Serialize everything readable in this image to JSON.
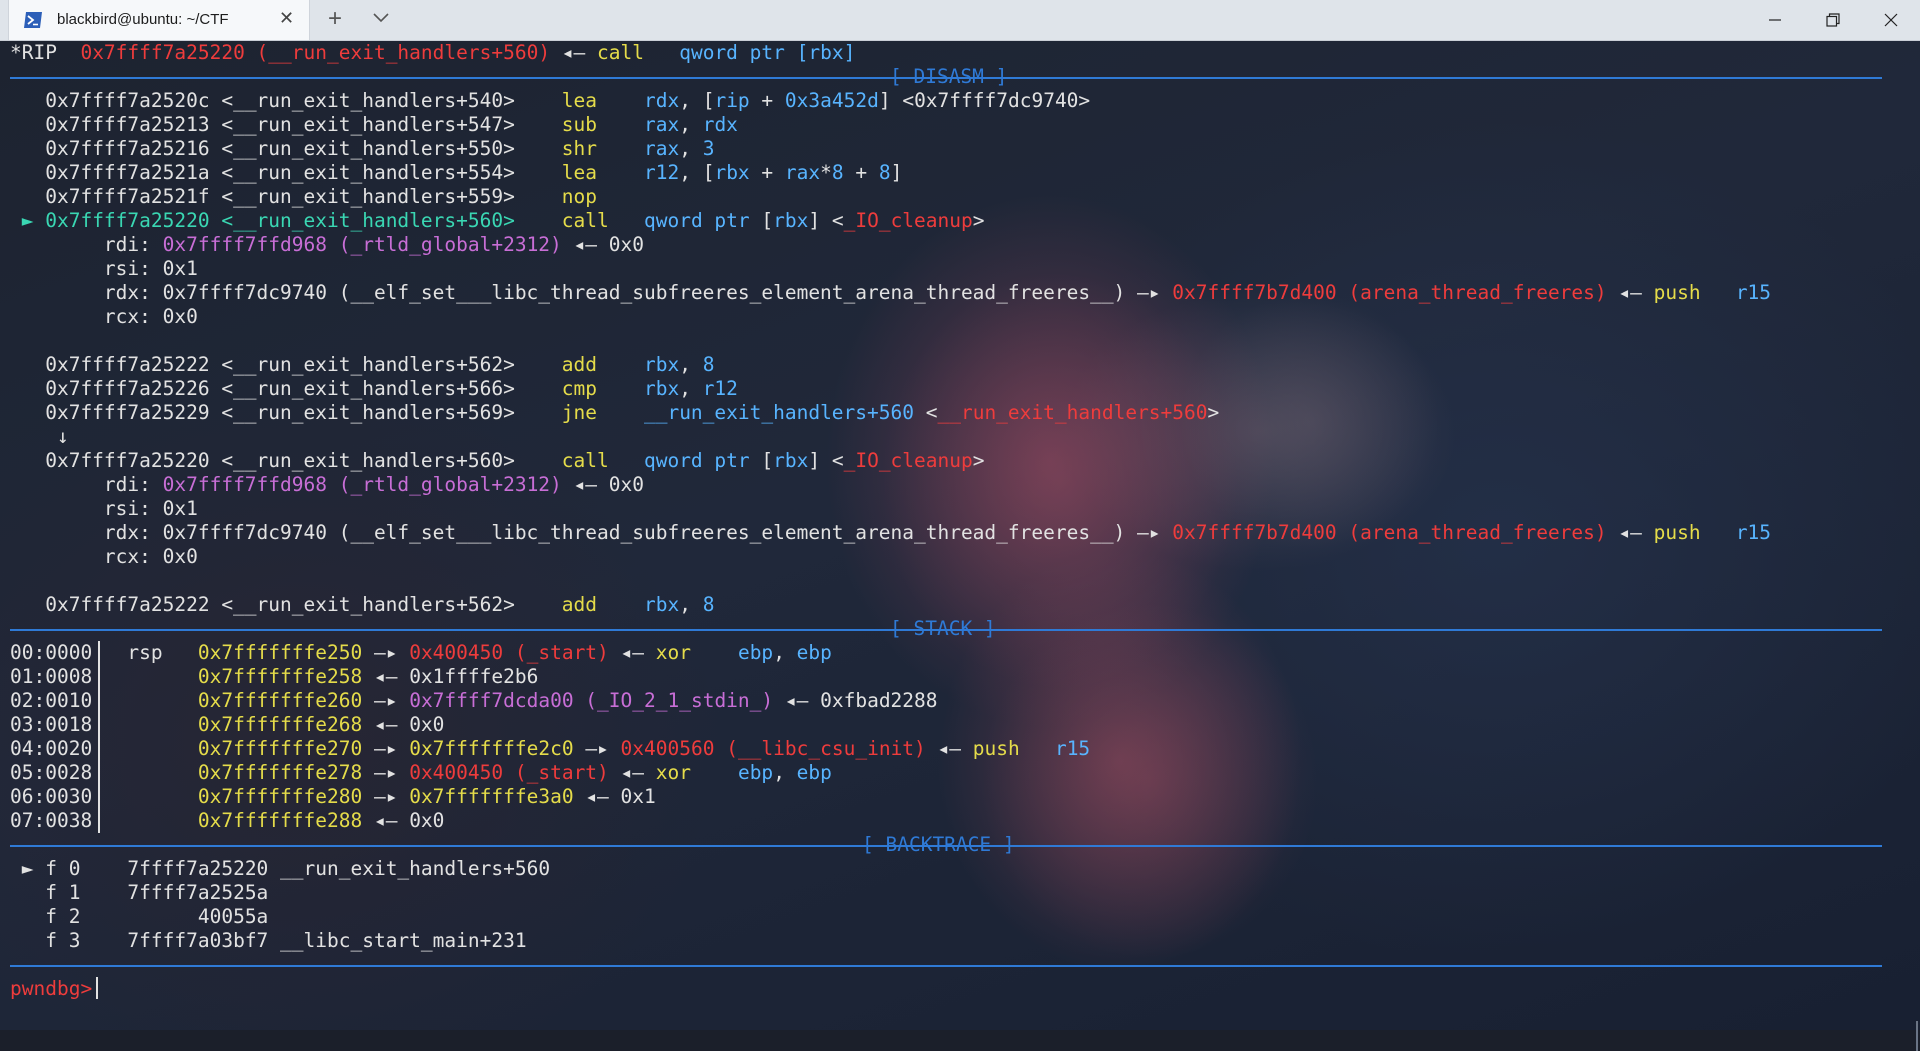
{
  "window": {
    "tab_title": "blackbird@ubuntu: ~/CTF",
    "new_tab": "+",
    "tab_close": "✕"
  },
  "sections": {
    "disasm": "[ DISASM ]",
    "stack": "[ STACK ]",
    "backtrace": "[ BACKTRACE ]"
  },
  "rip": {
    "label": "*RIP",
    "addr": "0x7ffff7a25220",
    "sym": "(__run_exit_handlers+560)",
    "arrow": "◂—",
    "ins": "call",
    "ops": "qword ptr [rbx]"
  },
  "disasm": [
    {
      "marker": "",
      "addr": "0x7ffff7a2520c",
      "sym": "<__run_exit_handlers+540>",
      "mn": "lea",
      "ops": [
        [
          "rdx",
          "b"
        ],
        [
          ", ",
          "w"
        ],
        [
          "[",
          "w"
        ],
        [
          "rip",
          "b"
        ],
        [
          " + ",
          "w"
        ],
        [
          "0x3a452d",
          "b"
        ],
        [
          "] <0x7ffff7dc9740>",
          "w"
        ]
      ]
    },
    {
      "marker": "",
      "addr": "0x7ffff7a25213",
      "sym": "<__run_exit_handlers+547>",
      "mn": "sub",
      "ops": [
        [
          "rax",
          "b"
        ],
        [
          ", ",
          "w"
        ],
        [
          "rdx",
          "b"
        ]
      ]
    },
    {
      "marker": "",
      "addr": "0x7ffff7a25216",
      "sym": "<__run_exit_handlers+550>",
      "mn": "shr",
      "ops": [
        [
          "rax",
          "b"
        ],
        [
          ", ",
          "w"
        ],
        [
          "3",
          "b"
        ]
      ]
    },
    {
      "marker": "",
      "addr": "0x7ffff7a2521a",
      "sym": "<__run_exit_handlers+554>",
      "mn": "lea",
      "ops": [
        [
          "r12",
          "b"
        ],
        [
          ", ",
          "w"
        ],
        [
          "[",
          "w"
        ],
        [
          "rbx",
          "b"
        ],
        [
          " + ",
          "w"
        ],
        [
          "rax",
          "b"
        ],
        [
          "*",
          "w"
        ],
        [
          "8",
          "b"
        ],
        [
          " + ",
          "w"
        ],
        [
          "8",
          "b"
        ],
        [
          "]",
          "w"
        ]
      ]
    },
    {
      "marker": "",
      "addr": "0x7ffff7a2521f",
      "sym": "<__run_exit_handlers+559>",
      "mn": "nop",
      "ops": []
    },
    {
      "marker": "►",
      "addr": "0x7ffff7a25220",
      "sym": "<__run_exit_handlers+560>",
      "mn": "call",
      "ops": [
        [
          "qword ptr ",
          "b"
        ],
        [
          "[",
          "w"
        ],
        [
          "rbx",
          "b"
        ],
        [
          "] <",
          "w"
        ],
        [
          "_IO_cleanup",
          "r"
        ],
        [
          ">",
          "w"
        ]
      ]
    }
  ],
  "args1": {
    "rdi": {
      "name": "rdi:",
      "val": "0x7ffff7ffd968",
      "sym": "(_rtld_global+2312)",
      "arrow": "◂—",
      "deref": "0x0"
    },
    "rsi": {
      "name": "rsi:",
      "val": "0x1"
    },
    "rdx": {
      "name": "rdx:",
      "val": "0x7ffff7dc9740",
      "sym": "(__elf_set___libc_thread_subfreeres_element_arena_thread_freeres__)",
      "arrow": "—▸",
      "ptr": "0x7ffff7b7d400",
      "ptrsym": "(arena_thread_freeres)",
      "arrow2": "◂—",
      "ins": "push",
      "reg": "r15"
    },
    "rcx": {
      "name": "rcx:",
      "val": "0x0"
    }
  },
  "disasm2": [
    {
      "addr": "0x7ffff7a25222",
      "sym": "<__run_exit_handlers+562>",
      "mn": "add",
      "ops": [
        [
          "rbx",
          "b"
        ],
        [
          ", ",
          "w"
        ],
        [
          "8",
          "b"
        ]
      ]
    },
    {
      "addr": "0x7ffff7a25226",
      "sym": "<__run_exit_handlers+566>",
      "mn": "cmp",
      "ops": [
        [
          "rbx",
          "b"
        ],
        [
          ", ",
          "w"
        ],
        [
          "r12",
          "b"
        ]
      ]
    },
    {
      "addr": "0x7ffff7a25229",
      "sym": "<__run_exit_handlers+569>",
      "mn": "jne",
      "ops": [
        [
          "__run_exit_handlers+560",
          "b"
        ],
        [
          " <",
          "w"
        ],
        [
          "__run_exit_handlers+560",
          "r"
        ],
        [
          ">",
          "w"
        ]
      ]
    }
  ],
  "jump_arrow": "↓",
  "disasm3": {
    "addr": "0x7ffff7a25220",
    "sym": "<__run_exit_handlers+560>",
    "mn": "call",
    "ops": [
      [
        "qword ptr ",
        "b"
      ],
      [
        "[",
        "w"
      ],
      [
        "rbx",
        "b"
      ],
      [
        "] <",
        "w"
      ],
      [
        "_IO_cleanup",
        "r"
      ],
      [
        ">",
        "w"
      ]
    ]
  },
  "disasm4": {
    "addr": "0x7ffff7a25222",
    "sym": "<__run_exit_handlers+562>",
    "mn": "add",
    "ops": [
      [
        "rbx",
        "b"
      ],
      [
        ", ",
        "w"
      ],
      [
        "8",
        "b"
      ]
    ]
  },
  "stack": [
    {
      "idx": "00:0000",
      "reg": "rsp",
      "addr": "0x7fffffffe250",
      "parts": [
        [
          "—▸ ",
          "w"
        ],
        [
          "0x400450 (_start)",
          "r"
        ],
        [
          " ◂— ",
          "w"
        ],
        [
          "xor    ",
          "y"
        ],
        [
          "ebp",
          "b"
        ],
        [
          ", ",
          "w"
        ],
        [
          "ebp",
          "b"
        ]
      ]
    },
    {
      "idx": "01:0008",
      "reg": "",
      "addr": "0x7fffffffe258",
      "parts": [
        [
          "◂— 0x1ffffe2b6",
          "w"
        ]
      ]
    },
    {
      "idx": "02:0010",
      "reg": "",
      "addr": "0x7fffffffe260",
      "parts": [
        [
          "—▸ ",
          "w"
        ],
        [
          "0x7ffff7dcda00 (_IO_2_1_stdin_)",
          "m"
        ],
        [
          " ◂— 0xfbad2288",
          "w"
        ]
      ]
    },
    {
      "idx": "03:0018",
      "reg": "",
      "addr": "0x7fffffffe268",
      "parts": [
        [
          "◂— 0x0",
          "w"
        ]
      ]
    },
    {
      "idx": "04:0020",
      "reg": "",
      "addr": "0x7fffffffe270",
      "parts": [
        [
          "—▸ ",
          "w"
        ],
        [
          "0x7fffffffe2c0",
          "y"
        ],
        [
          " —▸ ",
          "w"
        ],
        [
          "0x400560 (__libc_csu_init)",
          "r"
        ],
        [
          " ◂— ",
          "w"
        ],
        [
          "push   ",
          "y"
        ],
        [
          "r15",
          "b"
        ]
      ]
    },
    {
      "idx": "05:0028",
      "reg": "",
      "addr": "0x7fffffffe278",
      "parts": [
        [
          "—▸ ",
          "w"
        ],
        [
          "0x400450 (_start)",
          "r"
        ],
        [
          " ◂— ",
          "w"
        ],
        [
          "xor    ",
          "y"
        ],
        [
          "ebp",
          "b"
        ],
        [
          ", ",
          "w"
        ],
        [
          "ebp",
          "b"
        ]
      ]
    },
    {
      "idx": "06:0030",
      "reg": "",
      "addr": "0x7fffffffe280",
      "parts": [
        [
          "—▸ ",
          "w"
        ],
        [
          "0x7fffffffe3a0",
          "y"
        ],
        [
          " ◂— 0x1",
          "w"
        ]
      ]
    },
    {
      "idx": "07:0038",
      "reg": "",
      "addr": "0x7fffffffe288",
      "parts": [
        [
          "◂— 0x0",
          "w"
        ]
      ]
    }
  ],
  "backtrace": [
    {
      "marker": "►",
      "frame": "f 0",
      "addr": "    7ffff7a25220",
      "sym": "__run_exit_handlers+560"
    },
    {
      "marker": "",
      "frame": "f 1",
      "addr": "    7ffff7a2525a",
      "sym": ""
    },
    {
      "marker": "",
      "frame": "f 2",
      "addr": "          40055a",
      "sym": ""
    },
    {
      "marker": "",
      "frame": "f 3",
      "addr": "    7ffff7a03bf7",
      "sym": "__libc_start_main+231"
    }
  ],
  "prompt": "pwndbg>",
  "colors": {
    "accent": "#2f7ad6",
    "yellow": "#e5dc4a",
    "blue": "#58b4ff",
    "red": "#ee3c3c",
    "magenta": "#c86ed6",
    "green": "#3ad7b3"
  }
}
